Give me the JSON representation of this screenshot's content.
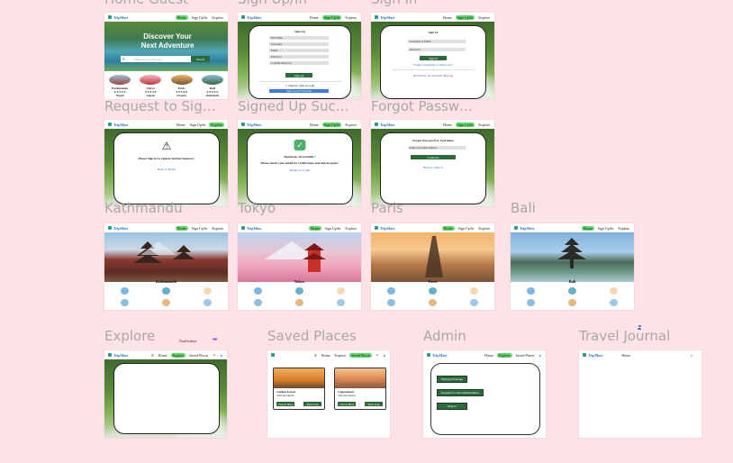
{
  "frames": {
    "home_guest": "Home Guest",
    "signup": "Sign Up/In",
    "signin": "Sign In",
    "request_signin": "Request to Sig…",
    "signed_up": "Signed Up Suc…",
    "forgot": "Forgot Passw…",
    "kathmandu": "Kathmandu",
    "tokyo": "Tokyo",
    "paris": "Paris",
    "bali": "Bali",
    "explore": "Explore",
    "saved": "Saved Places",
    "admin": "Admin",
    "journal": "Travel Journal"
  },
  "nav": {
    "logo": "TripMate",
    "home": "Home",
    "signup": "Sign Up/In",
    "explore": "Explore",
    "saved": "Saved Places"
  },
  "home": {
    "hero_line1": "Discover Your",
    "hero_line2": "Next Adventure",
    "search_placeholder": "Where do you want to go",
    "search_btn": "Search",
    "dest1": "Kathmandu",
    "dest1_sub": "Nepal",
    "dest2": "Tokyo",
    "dest2_sub": "Japan",
    "dest3": "Paris",
    "dest3_sub": "France",
    "dest4": "Bali",
    "dest4_sub": "Indonesia"
  },
  "signup": {
    "title": "Sign Up",
    "f1": "Full Name",
    "f2": "Username",
    "f3": "Email",
    "f4": "Password",
    "f5": "Confirm Password",
    "btn": "Sign up",
    "google": "Sign up with Google",
    "google_btn": "Sign up with Facebook"
  },
  "signin": {
    "title": "Sign In",
    "f1": "Username or Email",
    "f2": "Password",
    "btn": "Sign in",
    "forgot": "Forgot Username or Password?",
    "no_account": "Don't have an account? Sign up"
  },
  "request": {
    "text": "Please Sign in to explore further features !",
    "link": "Back to Home"
  },
  "signed_up": {
    "line1": "Signed up successfully !",
    "line2": "Please check your email for verification and sign in again !",
    "link": "Return to Login"
  },
  "forgot": {
    "title": "Forgot Password or Username",
    "field": "Enter your email address",
    "btn": "Continue",
    "link": "Back to Sign in"
  },
  "cities": {
    "kathmandu": "Kathmandu",
    "tokyo": "Tokyo",
    "paris": "Paris",
    "bali": "Bali"
  },
  "explore": {
    "notification": "Notification"
  },
  "saved": {
    "place1": "Golden Forest",
    "place1_sub": "Visit description",
    "place2": "Cappadocia",
    "place2_sub": "Visit description",
    "check_btn": "Check Here",
    "plan_btn": "Plan Trip"
  },
  "admin": {
    "btn1": "Manage Package",
    "btn2": "Request for Recommendation",
    "btn3": "Report"
  },
  "colors": {
    "canvas": "#fde2e6",
    "accent_green": "#5ddc6a",
    "dark_green": "#2e6b3a",
    "brand_blue": "#2a6fc0"
  }
}
